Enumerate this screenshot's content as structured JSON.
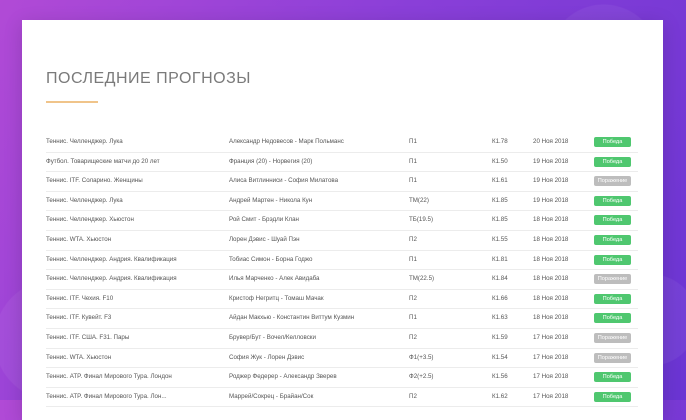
{
  "section": {
    "title": "Последние прогнозы"
  },
  "colors": {
    "win": "#4fc76f",
    "lose": "#bdbdbd",
    "accent": "#f0c48a"
  },
  "rows": [
    {
      "sport": "Теннис. Челленджер. Лука",
      "match": "Александр Недовесов - Марк Польманс",
      "bet": "П1",
      "coef": "К1.78",
      "date": "20 Ноя 2018",
      "status": "Победа",
      "win": true
    },
    {
      "sport": "Футбол. Товарищеские матчи до 20 лет",
      "match": "Франция (20) - Норвегия (20)",
      "bet": "П1",
      "coef": "К1.50",
      "date": "19 Ноя 2018",
      "status": "Победа",
      "win": true
    },
    {
      "sport": "Теннис. ITF. Соларино. Женщины",
      "match": "Алиса Витлинниси - София Милатова",
      "bet": "П1",
      "coef": "К1.61",
      "date": "19 Ноя 2018",
      "status": "Поражение",
      "win": false
    },
    {
      "sport": "Теннис. Челленджер. Лука",
      "match": "Андрей Мартен - Никола Кун",
      "bet": "ТМ(22)",
      "coef": "К1.85",
      "date": "19 Ноя 2018",
      "status": "Победа",
      "win": true
    },
    {
      "sport": "Теннис. Челленджер. Хьюстон",
      "match": "Рой Смит - Брэдли Клан",
      "bet": "ТБ(19.5)",
      "coef": "К1.85",
      "date": "18 Ноя 2018",
      "status": "Победа",
      "win": true
    },
    {
      "sport": "Теннис. WTA. Хьюстон",
      "match": "Лорен Дэвис - Шуай Пэн",
      "bet": "П2",
      "coef": "К1.55",
      "date": "18 Ноя 2018",
      "status": "Победа",
      "win": true
    },
    {
      "sport": "Теннис. Челленджер. Андрия. Квалификация",
      "match": "Тобиас Симон - Борна Годжо",
      "bet": "П1",
      "coef": "К1.81",
      "date": "18 Ноя 2018",
      "status": "Победа",
      "win": true
    },
    {
      "sport": "Теннис. Челленджер. Андрия. Квалификация",
      "match": "Илья Марченко - Алек Авидаба",
      "bet": "ТМ(22.5)",
      "coef": "К1.84",
      "date": "18 Ноя 2018",
      "status": "Поражение",
      "win": false
    },
    {
      "sport": "Теннис. ITF. Чехия. F10",
      "match": "Кристоф Негритц - Томаш Мачак",
      "bet": "П2",
      "coef": "К1.66",
      "date": "18 Ноя 2018",
      "status": "Победа",
      "win": true
    },
    {
      "sport": "Теннис. ITF. Кувейт. F3",
      "match": "Айдан Макхью - Константин Виттум Кузмин",
      "bet": "П1",
      "coef": "К1.63",
      "date": "18 Ноя 2018",
      "status": "Победа",
      "win": true
    },
    {
      "sport": "Теннис. ITF. США. F31. Пары",
      "match": "Брувер/Бут - Вочел/Келловски",
      "bet": "П2",
      "coef": "К1.59",
      "date": "17 Ноя 2018",
      "status": "Поражение",
      "win": false
    },
    {
      "sport": "Теннис. WTA. Хьюстон",
      "match": "София Жук - Лорен Дэвис",
      "bet": "Ф1(+3.5)",
      "coef": "К1.54",
      "date": "17 Ноя 2018",
      "status": "Поражение",
      "win": false
    },
    {
      "sport": "Теннис. ATP. Финал Мирового Тура. Лондон",
      "match": "Роджер Федерер - Александр Зверев",
      "bet": "Ф2(+2.5)",
      "coef": "К1.56",
      "date": "17 Ноя 2018",
      "status": "Победа",
      "win": true
    },
    {
      "sport": "Теннис. ATP. Финал Мирового Тура. Лон...",
      "match": "Маррей/Сокрец - Брайан/Сок",
      "bet": "П2",
      "coef": "К1.62",
      "date": "17 Ноя 2018",
      "status": "Победа",
      "win": true
    }
  ]
}
